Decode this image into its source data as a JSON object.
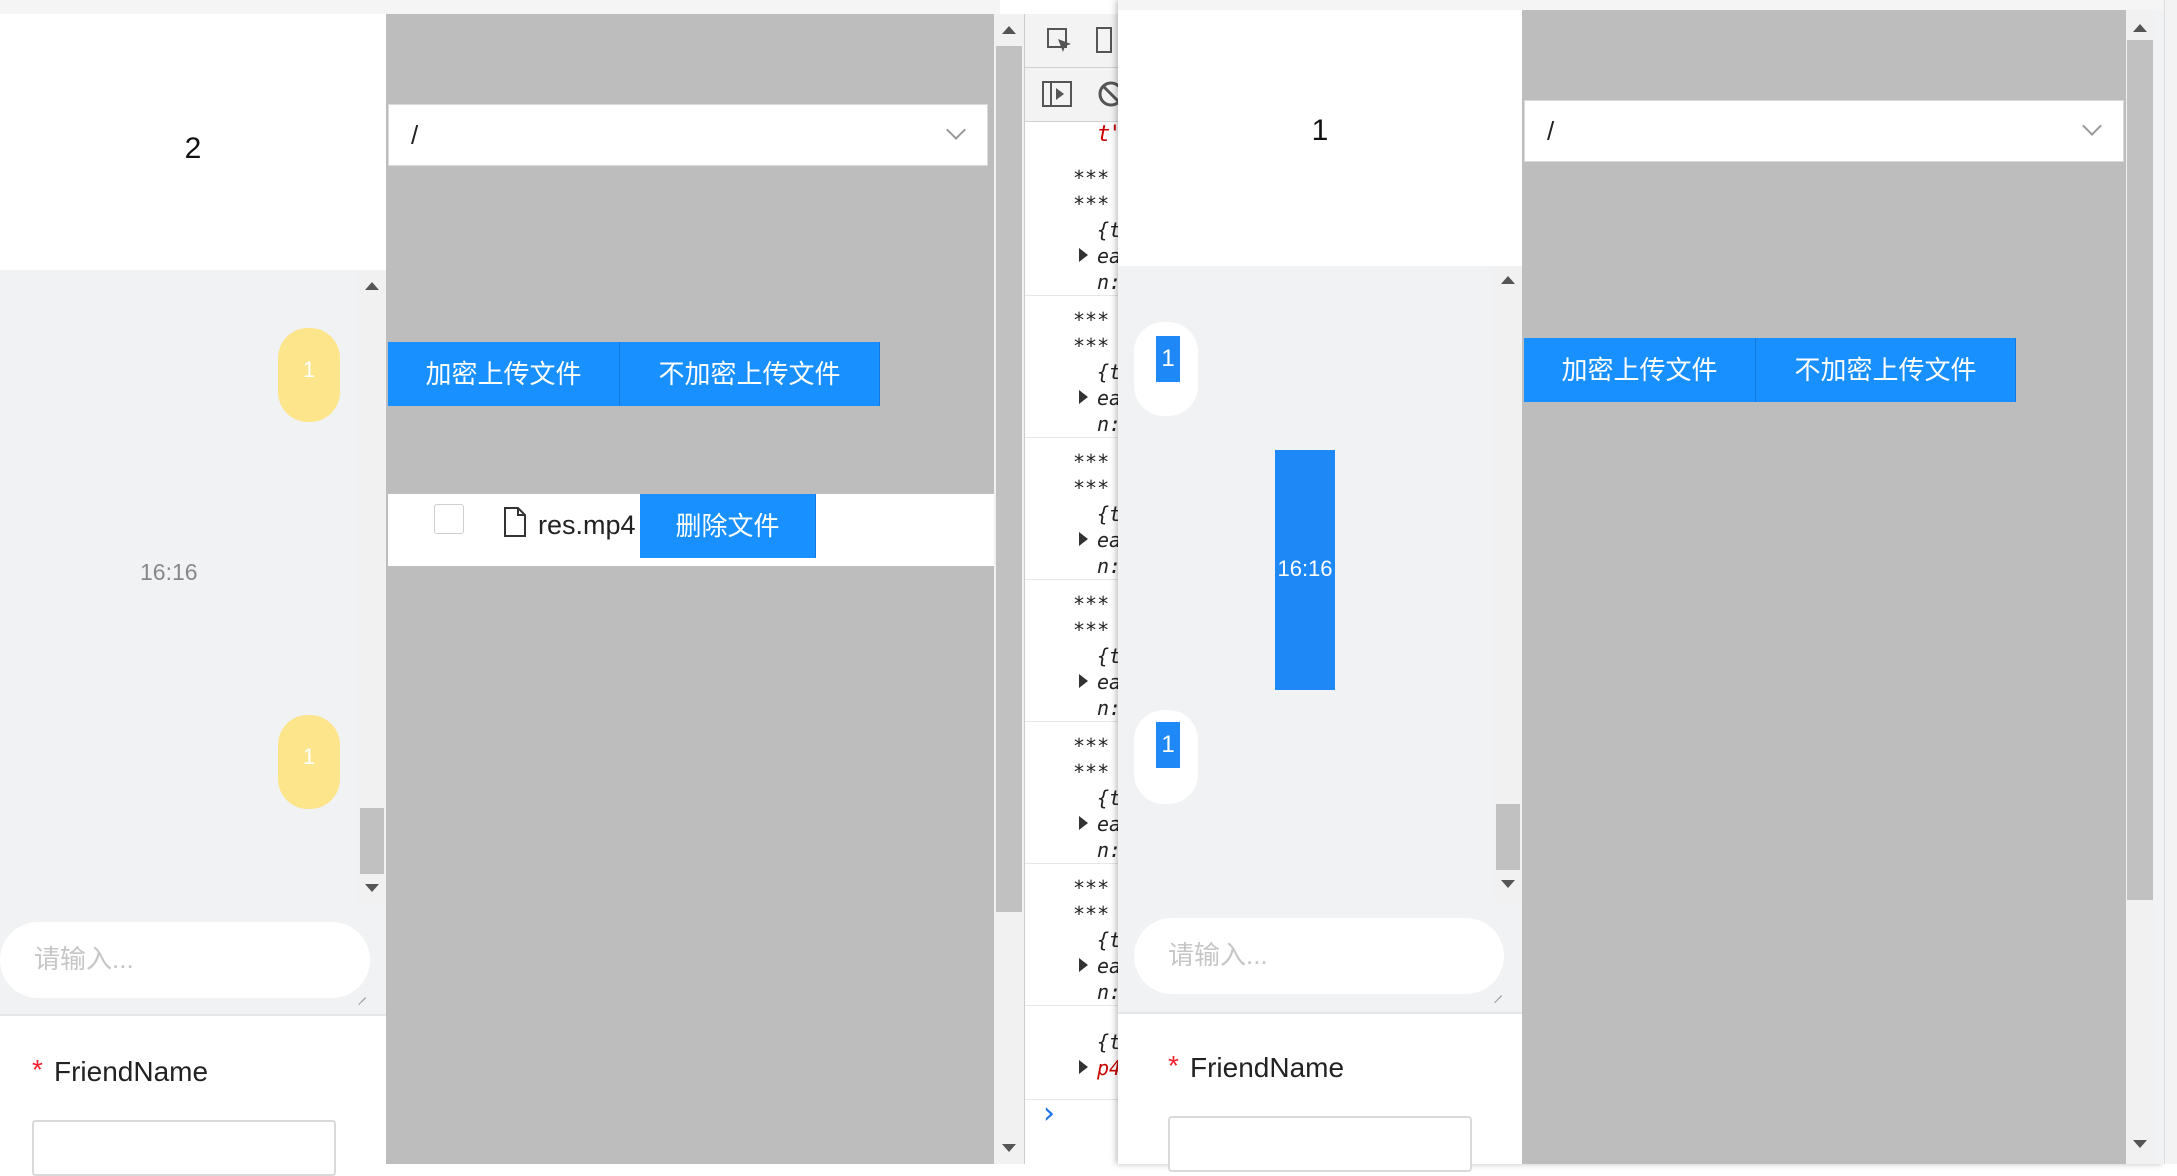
{
  "window_left": {
    "chat_title": "2",
    "messages": [
      {
        "text": "1"
      },
      {
        "text": "1"
      }
    ],
    "time": "16:16",
    "input_placeholder": "请输入...",
    "form": {
      "required_mark": "*",
      "label": "FriendName"
    },
    "path_select": "/",
    "buttons": {
      "encrypt_upload": "加密上传文件",
      "plain_upload": "不加密上传文件",
      "delete_file": "删除文件"
    },
    "file": {
      "name": "res.mp4"
    }
  },
  "window_right": {
    "chat_title": "1",
    "messages": [
      {
        "text": "1"
      },
      {
        "text": "1"
      }
    ],
    "time": "16:16",
    "input_placeholder": "请输入...",
    "form": {
      "required_mark": "*",
      "label": "FriendName"
    },
    "path_select": "/",
    "buttons": {
      "encrypt_upload": "加密上传文件",
      "plain_upload": "不加密上传文件"
    }
  },
  "devtools": {
    "top_red": "t\"",
    "entries": [
      {
        "l1": "***",
        "l2": "***",
        "l3": "{t",
        "l4": "ea",
        "l5": "n:"
      },
      {
        "l1": "***",
        "l2": "***",
        "l3": "{t",
        "l4": "ea",
        "l5": "n:"
      },
      {
        "l1": "***",
        "l2": "***",
        "l3": "{t",
        "l4": "ea",
        "l5": "n:"
      },
      {
        "l1": "***",
        "l2": "***",
        "l3": "{t",
        "l4": "ea",
        "l5": "n:"
      },
      {
        "l1": "***",
        "l2": "***",
        "l3": "{t",
        "l4": "ea",
        "l5": "n:"
      },
      {
        "l1": "***",
        "l2": "***",
        "l3": "{t",
        "l4": "ea",
        "l5": "n:"
      }
    ],
    "last_l1": "{t",
    "last_l2": "p4",
    "prompt": "›"
  },
  "colors": {
    "accent": "#1890ff",
    "panel_gray": "#bdbdbd",
    "bubble_yellow": "#fde58b",
    "required": "#f5222d"
  }
}
